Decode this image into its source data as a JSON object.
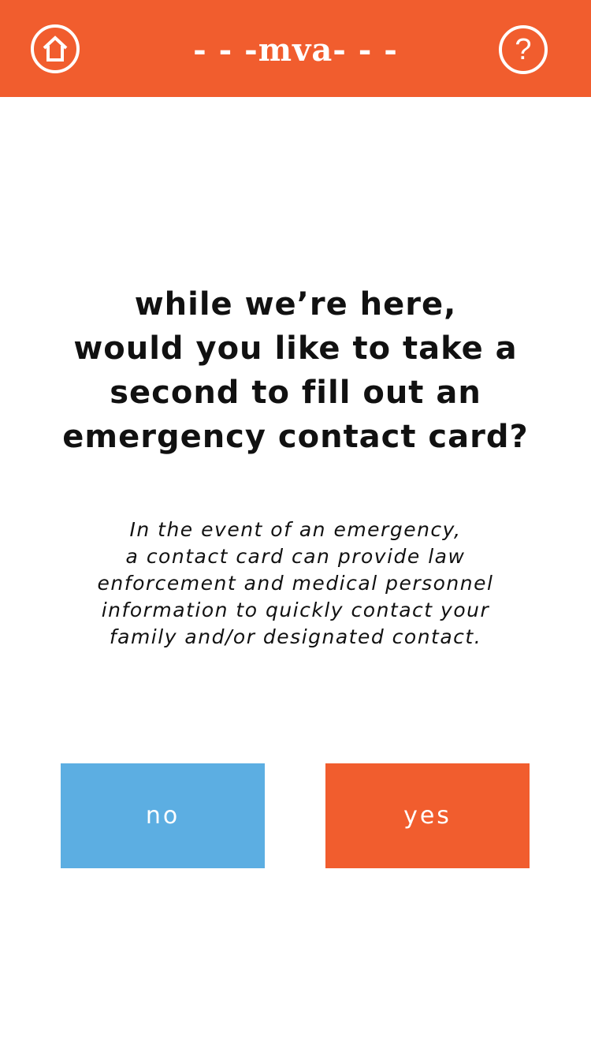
{
  "header": {
    "brand": "- - -mva- - -",
    "home_icon": "home-icon",
    "help_icon": "question-icon",
    "help_glyph": "?",
    "background_color": "#f15d2e"
  },
  "prompt": {
    "headline_lines": [
      "while we’re here,",
      "would you like to take a",
      "second to fill out an",
      "emergency contact card?"
    ],
    "body_lines": [
      "In the event of an emergency,",
      "a contact card can provide law",
      "enforcement and medical personnel",
      "information to quickly contact your",
      "family and/or designated contact."
    ]
  },
  "actions": {
    "no_label": "no",
    "yes_label": "yes",
    "no_color": "#5caee2",
    "yes_color": "#f15d2e"
  }
}
